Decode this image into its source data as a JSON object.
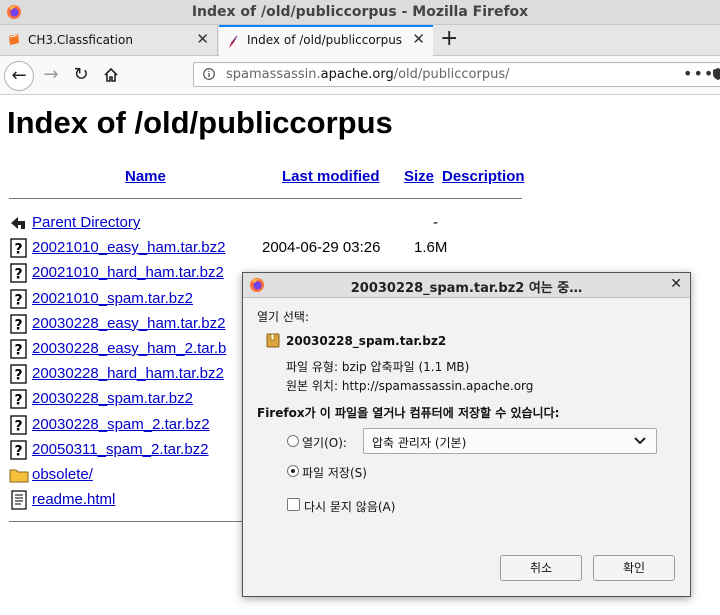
{
  "window": {
    "title": "Index of /old/publiccorpus - Mozilla Firefox"
  },
  "tabs": [
    {
      "label": "CH3.Classfication"
    },
    {
      "label": "Index of /old/publiccorpus"
    }
  ],
  "urlbar": {
    "prefix": "spamassassin.",
    "domain": "apache.org",
    "path": "/old/publiccorpus/"
  },
  "page": {
    "heading": "Index of /old/publiccorpus",
    "columns": {
      "name": "Name",
      "modified": "Last modified",
      "size": "Size",
      "description": "Description"
    },
    "entries": [
      {
        "icon": "back-icon",
        "name": "Parent Directory",
        "date": "",
        "size": "-"
      },
      {
        "icon": "file-unknown-icon",
        "name": "20021010_easy_ham.tar.bz2",
        "date": "2004-06-29 03:26",
        "size": "1.6M"
      },
      {
        "icon": "file-unknown-icon",
        "name": "20021010_hard_ham.tar.bz2",
        "date": "",
        "size": ""
      },
      {
        "icon": "file-unknown-icon",
        "name": "20021010_spam.tar.bz2",
        "date": "",
        "size": ""
      },
      {
        "icon": "file-unknown-icon",
        "name": "20030228_easy_ham.tar.bz2",
        "date": "",
        "size": ""
      },
      {
        "icon": "file-unknown-icon",
        "name": "20030228_easy_ham_2.tar.b",
        "date": "",
        "size": ""
      },
      {
        "icon": "file-unknown-icon",
        "name": "20030228_hard_ham.tar.bz2",
        "date": "",
        "size": ""
      },
      {
        "icon": "file-unknown-icon",
        "name": "20030228_spam.tar.bz2",
        "date": "",
        "size": ""
      },
      {
        "icon": "file-unknown-icon",
        "name": "20030228_spam_2.tar.bz2",
        "date": "",
        "size": ""
      },
      {
        "icon": "file-unknown-icon",
        "name": "20050311_spam_2.tar.bz2",
        "date": "",
        "size": ""
      },
      {
        "icon": "folder-icon",
        "name": "obsolete/",
        "date": "",
        "size": ""
      },
      {
        "icon": "text-file-icon",
        "name": "readme.html",
        "date": "",
        "size": ""
      }
    ]
  },
  "dialog": {
    "title": "20030228_spam.tar.bz2 여는 중…",
    "open_label": "열기 선택:",
    "file_name": "20030228_spam.tar.bz2",
    "file_type": "파일 유형:  bzip 압축파일 (1.1 MB)",
    "source": "원본 위치:  http://spamassassin.apache.org",
    "question": "Firefox가 이 파일을 열거나 컴퓨터에 저장할 수 있습니다:",
    "open_with_label": "열기(O):",
    "open_with_value": "압축 관리자 (기본)",
    "save_label": "파일 저장(S)",
    "selected_option": "save",
    "dont_ask_label": "다시 묻지 않음(A)",
    "cancel_label": "취소",
    "ok_label": "확인"
  }
}
